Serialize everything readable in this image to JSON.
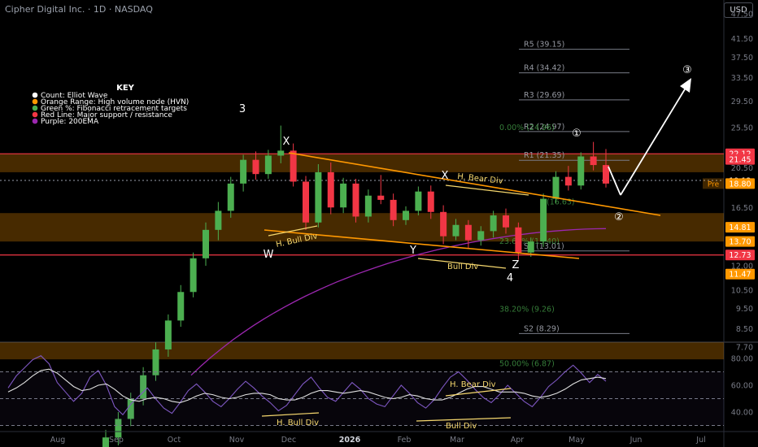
{
  "header": {
    "title": "Cipher Digital Inc. · 1D · NASDAQ",
    "currency_button": "USD"
  },
  "key": {
    "title": "KEY",
    "items": [
      {
        "label": "Count: Elliot Wave",
        "color": "#ffffff"
      },
      {
        "label": "Orange Range: High volume node (HVN)",
        "color": "#ff9800"
      },
      {
        "label": "Green %: Fibonacci retracement targets",
        "color": "#4caf50"
      },
      {
        "label": "Red Line: Major support / resistance",
        "color": "#f23645"
      },
      {
        "label": "Purple: 200EMA",
        "color": "#9c27b0"
      }
    ]
  },
  "chart_data": [
    {
      "type": "candlestick",
      "title": "Cipher Digital Inc. · 1D · NASDAQ",
      "price_axis_ticks": [
        "47.50",
        "41.50",
        "37.50",
        "33.50",
        "29.50",
        "25.50",
        "20.50",
        "16.50",
        "12.00",
        "10.50",
        "9.50",
        "8.50",
        "7.70"
      ],
      "time_axis_labels": [
        "Aug",
        "Sep",
        "Oct",
        "Nov",
        "Dec",
        "2026",
        "Feb",
        "Mar",
        "Apr",
        "May",
        "Jun",
        "Jul"
      ],
      "price_badges": [
        {
          "value": "22.12",
          "color": "#f23645",
          "y": 22.12
        },
        {
          "value": "21.45",
          "color": "#f23645",
          "y": 21.45
        },
        {
          "value": "19.12",
          "color": "#000000",
          "y": 19.12
        },
        {
          "value": "18.80",
          "color": "#ff9800",
          "y": 18.8,
          "tag": "Pre"
        },
        {
          "value": "14.81",
          "color": "#ff9800",
          "y": 14.81
        },
        {
          "value": "13.70",
          "color": "#ff9800",
          "y": 13.7
        },
        {
          "value": "12.73",
          "color": "#f23645",
          "y": 12.73
        },
        {
          "value": "11.47",
          "color": "#ff9800",
          "y": 11.47
        }
      ],
      "hvn_zones": [
        [
          20.0,
          22.12
        ],
        [
          13.7,
          16.0
        ],
        [
          7.2,
          7.9
        ]
      ],
      "red_lines": [
        22.12,
        12.73
      ],
      "current_price_line": 19.12,
      "pivot_levels": [
        {
          "label": "R5 (39.15)",
          "value": 39.15
        },
        {
          "label": "R4 (34.42)",
          "value": 34.42
        },
        {
          "label": "R3 (29.69)",
          "value": 29.69
        },
        {
          "label": "R2 (24.97)",
          "value": 24.97
        },
        {
          "label": "R1 (21.35)",
          "value": 21.35
        },
        {
          "label": "S1 (13.01)",
          "value": 13.01
        },
        {
          "label": "S2 (8.29)",
          "value": 8.29
        }
      ],
      "fib_labels": [
        {
          "label": "0.00% (24.96)",
          "value": 24.96
        },
        {
          "label": "(16.63)",
          "value": 16.63
        },
        {
          "label": "23.60% (13.40)",
          "value": 13.4
        },
        {
          "label": "38.20% (9.26)",
          "value": 9.26
        },
        {
          "label": "50.00% (6.87)",
          "value": 6.87
        }
      ],
      "wave_labels": [
        "3",
        "X",
        "W",
        "X",
        "Y",
        "Z",
        "4",
        "①",
        "②",
        "③"
      ],
      "annotations": [
        "H. Bull Div",
        "H. Bear Div",
        "Bull Div"
      ],
      "ema200": {
        "name": "Purple: 200EMA",
        "start": 6.6,
        "end": 14.7
      },
      "candles_ohlc_sample": [
        [
          4.4,
          4.9,
          4.1,
          4.7
        ],
        [
          4.7,
          5.4,
          4.5,
          5.2
        ],
        [
          5.2,
          6.0,
          5.0,
          5.8
        ],
        [
          5.8,
          6.9,
          5.6,
          6.6
        ],
        [
          6.6,
          7.9,
          6.4,
          7.6
        ],
        [
          7.6,
          9.2,
          7.3,
          8.9
        ],
        [
          8.9,
          10.8,
          8.6,
          10.4
        ],
        [
          10.4,
          12.9,
          10.1,
          12.5
        ],
        [
          12.5,
          15.2,
          12.0,
          14.6
        ],
        [
          14.6,
          17.0,
          13.8,
          16.2
        ],
        [
          16.2,
          19.5,
          15.6,
          18.8
        ],
        [
          18.8,
          22.0,
          18.0,
          21.4
        ],
        [
          21.4,
          22.4,
          19.2,
          19.8
        ],
        [
          19.8,
          22.6,
          19.3,
          21.9
        ],
        [
          21.9,
          25.8,
          21.0,
          22.5
        ],
        [
          22.5,
          23.4,
          18.5,
          19.0
        ],
        [
          19.0,
          19.6,
          14.6,
          15.2
        ],
        [
          15.2,
          20.9,
          14.8,
          20.0
        ],
        [
          20.0,
          21.1,
          15.9,
          16.5
        ],
        [
          16.5,
          19.4,
          16.0,
          18.8
        ],
        [
          18.8,
          19.3,
          15.2,
          15.7
        ],
        [
          15.7,
          18.2,
          15.2,
          17.6
        ],
        [
          17.6,
          19.7,
          16.8,
          17.2
        ],
        [
          17.2,
          17.8,
          14.9,
          15.4
        ],
        [
          15.4,
          16.6,
          15.0,
          16.2
        ],
        [
          16.2,
          18.5,
          15.8,
          18.0
        ],
        [
          18.0,
          18.6,
          15.5,
          16.1
        ],
        [
          16.1,
          16.7,
          13.5,
          14.1
        ],
        [
          14.1,
          15.5,
          13.8,
          15.0
        ],
        [
          15.0,
          15.4,
          13.2,
          13.8
        ],
        [
          13.8,
          14.9,
          13.4,
          14.5
        ],
        [
          14.5,
          16.2,
          14.0,
          15.8
        ],
        [
          15.8,
          16.4,
          14.3,
          14.8
        ],
        [
          14.8,
          15.2,
          12.4,
          12.9
        ],
        [
          12.9,
          14.0,
          12.6,
          13.7
        ],
        [
          13.7,
          17.8,
          13.3,
          17.3
        ],
        [
          17.3,
          20.1,
          16.9,
          19.5
        ],
        [
          19.5,
          20.7,
          18.1,
          18.6
        ],
        [
          18.6,
          22.3,
          18.2,
          21.8
        ],
        [
          21.8,
          23.6,
          20.2,
          20.8
        ],
        [
          20.8,
          22.7,
          18.4,
          18.8
        ]
      ]
    },
    {
      "type": "line",
      "title": "",
      "y_ticks": [
        "80.00",
        "60.00",
        "40.00"
      ],
      "ylim": [
        25,
        90
      ],
      "bands": [
        70,
        50,
        30
      ],
      "annotations": [
        "H. Bear Div",
        "H. Bull Div",
        "Bull Div"
      ],
      "series": [
        {
          "values": [
            58,
            67,
            73,
            79,
            82,
            76,
            62,
            55,
            48,
            54,
            66,
            71,
            60,
            44,
            38,
            46,
            52,
            58,
            50,
            43,
            39,
            47,
            56,
            61,
            55,
            48,
            44,
            50,
            57,
            63,
            58,
            52,
            47,
            41,
            45,
            53,
            61,
            66,
            58,
            51,
            48,
            55,
            62,
            57,
            50,
            46,
            44,
            52,
            60,
            54,
            47,
            43,
            49,
            58,
            66,
            70,
            64,
            57,
            51,
            47,
            53,
            60,
            54,
            48,
            44,
            51,
            59,
            64,
            70,
            75,
            69,
            62,
            68,
            63
          ]
        },
        {
          "values": [
            55,
            58,
            62,
            67,
            71,
            72,
            69,
            64,
            59,
            56,
            57,
            60,
            61,
            57,
            52,
            49,
            48,
            50,
            51,
            50,
            48,
            47,
            49,
            52,
            54,
            53,
            51,
            50,
            51,
            53,
            54,
            54,
            53,
            50,
            49,
            49,
            51,
            54,
            56,
            56,
            55,
            54,
            55,
            56,
            55,
            53,
            51,
            50,
            51,
            53,
            52,
            50,
            49,
            49,
            51,
            54,
            57,
            59,
            59,
            57,
            55,
            55,
            55,
            54,
            52,
            51,
            52,
            54,
            57,
            61,
            64,
            65,
            66,
            65
          ]
        }
      ]
    }
  ]
}
